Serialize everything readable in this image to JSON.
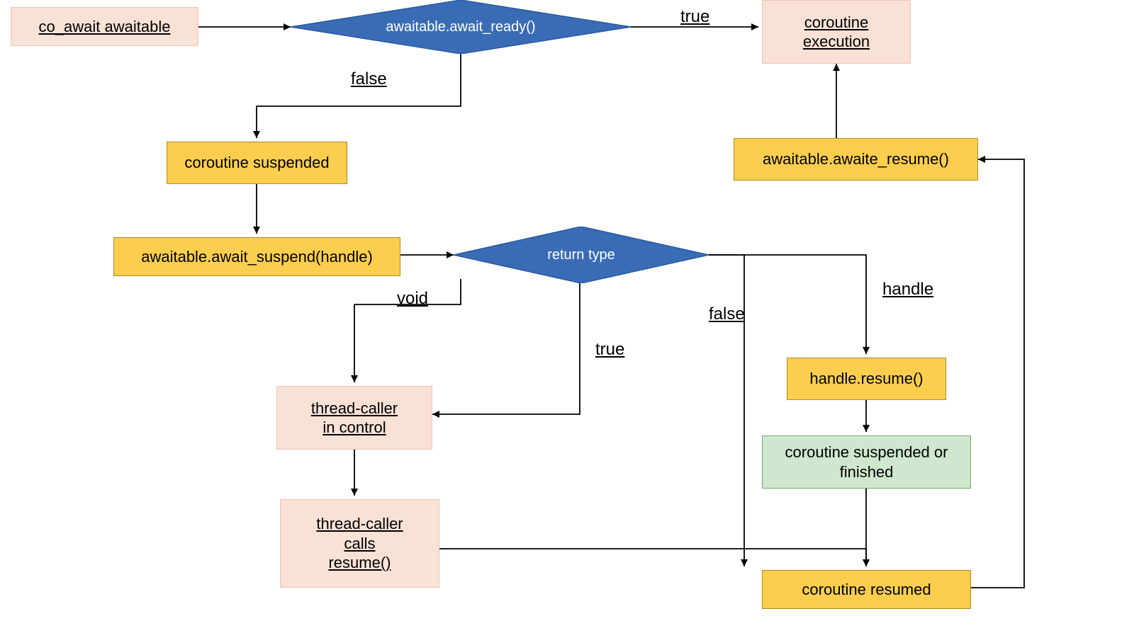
{
  "nodes": {
    "start": "co_await awaitable",
    "await_ready": "awaitable.await_ready()",
    "coroutine_exec": "coroutine\nexecution",
    "await_resume": "awaitable.awaite_resume()",
    "coroutine_suspended": "coroutine suspended",
    "await_suspend": "awaitable.await_suspend(handle)",
    "return_type": "return type",
    "thread_caller_control": "thread-caller\nin control",
    "thread_caller_resume": "thread-caller\ncalls\nresume()",
    "handle_resume": "handle.resume()",
    "susp_or_finished": "coroutine suspended or\nfinished",
    "coroutine_resumed": "coroutine resumed"
  },
  "edges": {
    "true1": "true",
    "false1": "false",
    "void": "void",
    "true2": "true",
    "false2": "false",
    "handle": "handle"
  },
  "colors": {
    "pink_bg": "#F9E1D6",
    "yellow_bg": "#FDCE4E",
    "green_bg": "#CFE7CF",
    "diamond_fill": "#3A6CB5",
    "arrow": "#000000"
  }
}
